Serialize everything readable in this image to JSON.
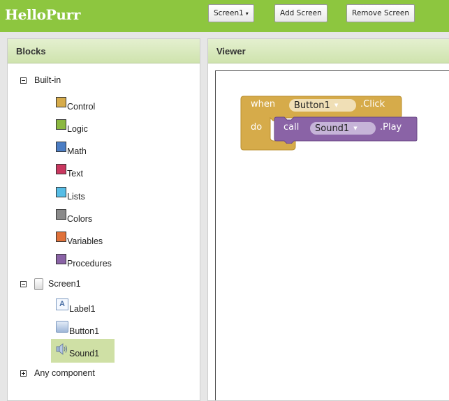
{
  "app": {
    "title": "HelloPurr"
  },
  "toolbar": {
    "screen_select": "Screen1",
    "add_screen": "Add Screen",
    "remove_screen": "Remove Screen"
  },
  "blocks_panel": {
    "title": "Blocks",
    "builtin": {
      "label": "Built-in",
      "categories": [
        {
          "label": "Control",
          "color": "#d6ab4a"
        },
        {
          "label": "Logic",
          "color": "#8bb840"
        },
        {
          "label": "Math",
          "color": "#4b7dc4"
        },
        {
          "label": "Text",
          "color": "#c9375f"
        },
        {
          "label": "Lists",
          "color": "#56bde6"
        },
        {
          "label": "Colors",
          "color": "#8a8a8a"
        },
        {
          "label": "Variables",
          "color": "#e0713a"
        },
        {
          "label": "Procedures",
          "color": "#8a63a6"
        }
      ]
    },
    "screen": {
      "label": "Screen1",
      "components": [
        {
          "label": "Label1",
          "icon": "label-icon"
        },
        {
          "label": "Button1",
          "icon": "button-icon"
        },
        {
          "label": "Sound1",
          "icon": "speaker-icon"
        }
      ],
      "selected": "Sound1"
    },
    "any_component": {
      "label": "Any component"
    }
  },
  "viewer": {
    "title": "Viewer",
    "event_block": {
      "when": "when",
      "component": "Button1",
      "event": ".Click",
      "do": "do",
      "color": "#d6ab4a"
    },
    "call_block": {
      "call": "call",
      "component": "Sound1",
      "method": ".Play",
      "color": "#8a63a6"
    }
  }
}
